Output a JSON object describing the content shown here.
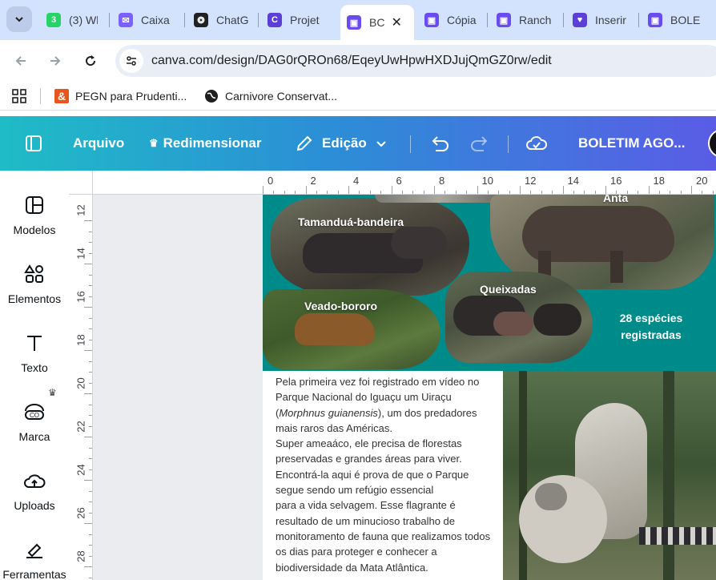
{
  "browser": {
    "tabs": [
      {
        "label": "(3) Wh",
        "favicon_text": "3",
        "favicon_color": "#25d366",
        "active": false
      },
      {
        "label": "Caixa",
        "favicon_text": "✉",
        "favicon_color": "#7b61ff",
        "active": false
      },
      {
        "label": "ChatG",
        "favicon_text": "❂",
        "favicon_color": "#202124",
        "active": false
      },
      {
        "label": "Projet",
        "favicon_text": "C",
        "favicon_color": "#5b3fd6",
        "active": false
      },
      {
        "label": "BC",
        "favicon_text": "▣",
        "favicon_color": "#6a4bf0",
        "active": true
      },
      {
        "label": "Cópia",
        "favicon_text": "▣",
        "favicon_color": "#6a4bf0",
        "active": false
      },
      {
        "label": "Ranch",
        "favicon_text": "▣",
        "favicon_color": "#6a4bf0",
        "active": false
      },
      {
        "label": "Inserir",
        "favicon_text": "♥",
        "favicon_color": "#5b3fd6",
        "active": false
      },
      {
        "label": "BOLE",
        "favicon_text": "▣",
        "favicon_color": "#6a4bf0",
        "active": false
      }
    ],
    "url": "canva.com/design/DAG0rQROn68/EqeyUwHpwHXDJujQmGZ0rw/edit",
    "bookmarks": [
      {
        "label": "PEGN para Prudenti...",
        "icon": "pegn-icon"
      },
      {
        "label": "Carnivore Conservat...",
        "icon": "globe-icon"
      }
    ]
  },
  "canva": {
    "menu": {
      "file": "Arquivo",
      "resize": "Redimensionar",
      "edit": "Edição",
      "title": "BOLETIM AGO..."
    },
    "sidebar": [
      {
        "label": "Modelos",
        "icon": "templates-icon"
      },
      {
        "label": "Elementos",
        "icon": "elements-icon"
      },
      {
        "label": "Texto",
        "icon": "text-icon"
      },
      {
        "label": "Marca",
        "icon": "brand-icon"
      },
      {
        "label": "Uploads",
        "icon": "uploads-icon"
      },
      {
        "label": "Ferramentas",
        "icon": "tools-icon"
      }
    ],
    "ruler_top": [
      "0",
      "2",
      "4",
      "6",
      "8",
      "10",
      "12",
      "14",
      "16",
      "18",
      "20"
    ],
    "ruler_left": [
      "12",
      "14",
      "16",
      "18",
      "20",
      "22",
      "24",
      "26",
      "28"
    ]
  },
  "design": {
    "animals": {
      "tamandua": "Tamanduá-bandeira",
      "anta": "Anta",
      "veado": "Veado-bororo",
      "queixadas": "Queixadas"
    },
    "species_count": "28  espécies\nregistradas",
    "article_text": "Pela primeira vez foi registrado em vídeo no Parque Nacional do Iguaçu um Uiraçu (",
    "article_italic": "Morphnus guianensis",
    "article_rest": "), um dos predadores mais raros das Américas.\nSuper ameaáco, ele precisa de florestas preservadas e grandes áreas para viver. Encontrá-la aqui é prova de que o Parque segue sendo um refúgio essencial\n para a vida selvagem. Esse flagrante é resultado de um minucioso trabalho de monitoramento de fauna que realizamos todos os dias para proteger e conhecer a biodiversidade da Mata Atlântica."
  }
}
